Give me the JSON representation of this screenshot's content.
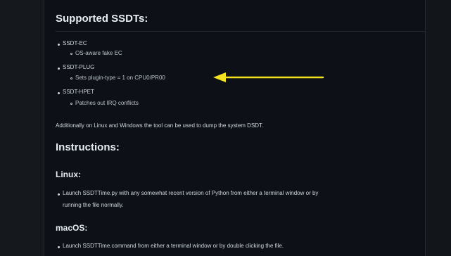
{
  "heading_supported": "Supported SSDTs:",
  "ssdts": [
    {
      "name": "SSDT-EC",
      "detail": "OS-aware fake EC"
    },
    {
      "name": "SSDT-PLUG",
      "detail": "Sets plugin-type = 1 on CPU0/PR00"
    },
    {
      "name": "SSDT-HPET",
      "detail": "Patches out IRQ conflicts"
    }
  ],
  "dsdt_note": "Additionally on Linux and Windows the tool can be used to dump the system DSDT.",
  "heading_instructions": "Instructions:",
  "linux": {
    "heading": "Linux:",
    "line1": "Launch SSDTTime.py with any somewhat recent version of Python from either a terminal window or by",
    "line2": "running the file normally."
  },
  "macos": {
    "heading": "macOS:",
    "line1": "Launch SSDTTime.command from either a terminal window or by double clicking the file."
  },
  "colors": {
    "arrow": "#f4e21f",
    "background": "#0d1117",
    "heading": "#e6edf3"
  },
  "icons": {
    "annotation": "left-arrow"
  }
}
